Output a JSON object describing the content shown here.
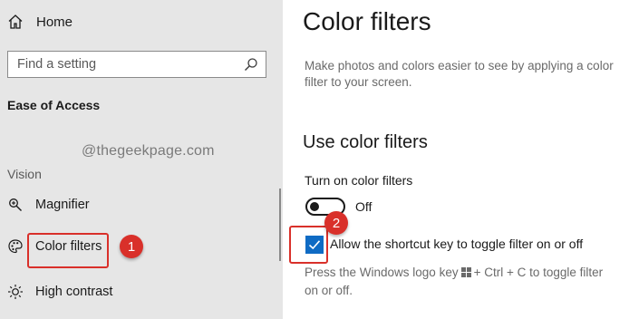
{
  "sidebar": {
    "home_label": "Home",
    "search_placeholder": "Find a setting",
    "section_title": "Ease of Access",
    "category": "Vision",
    "items": [
      {
        "label": "Magnifier",
        "icon": "magnifier-icon"
      },
      {
        "label": "Color filters",
        "icon": "color-palette-icon"
      },
      {
        "label": "High contrast",
        "icon": "brightness-icon"
      }
    ],
    "watermark": "@thegeekpage.com"
  },
  "main": {
    "title": "Color filters",
    "description_line1": "Make photos and colors easier to see by applying a color",
    "description_line2": "filter to your screen.",
    "subheading": "Use color filters",
    "toggle_label": "Turn on color filters",
    "toggle_state": "Off",
    "toggle_on": false,
    "checkbox_label": "Allow the shortcut key to toggle filter on or off",
    "checkbox_checked": true,
    "hint_part1": "Press the Windows logo key",
    "hint_part2": "+ Ctrl + C to toggle filter",
    "hint_line2": "on or off."
  },
  "annotations": {
    "badge1": "1",
    "badge2": "2",
    "color": "#d9302a"
  },
  "colors": {
    "accent": "#0f6bc4",
    "sidebar_bg": "#e6e6e6"
  }
}
